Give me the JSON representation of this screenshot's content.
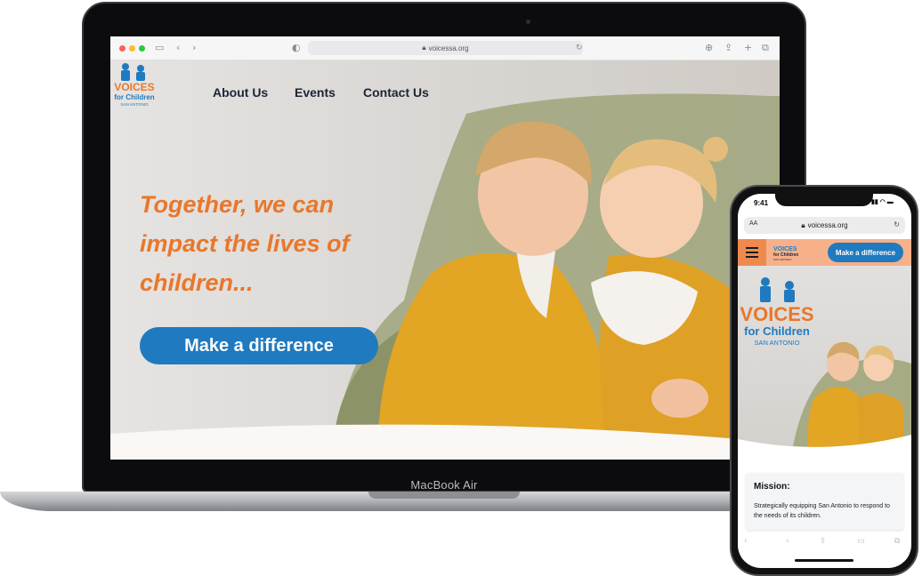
{
  "laptop": {
    "model_label": "MacBook Air",
    "browser": {
      "url": "voicessa.org"
    },
    "site": {
      "logo": {
        "line1": "VOICES",
        "line2": "for Children",
        "line3": "SAN ANTONIO"
      },
      "nav": [
        "About Us",
        "Events",
        "Contact Us"
      ],
      "headline": "Together, we can impact the lives of children...",
      "cta": "Make a difference"
    }
  },
  "phone": {
    "status": {
      "time": "9:41"
    },
    "browser": {
      "aa": "AA",
      "url": "voicessa.org"
    },
    "header": {
      "logo": {
        "line1": "VOICES",
        "line2": "for Children",
        "line3": "SAN ANTONIO"
      },
      "cta": "Make a difference"
    },
    "hero_logo": {
      "line1": "VOICES",
      "line2": "for Children",
      "line3": "SAN ANTONIO"
    },
    "mission": {
      "title": "Mission:",
      "text": "Strategically equipping San Antonio to respond to the needs of its children."
    }
  },
  "colors": {
    "brand_orange": "#e9772b",
    "brand_blue": "#1f7ac0",
    "nav_text": "#1b2436"
  }
}
